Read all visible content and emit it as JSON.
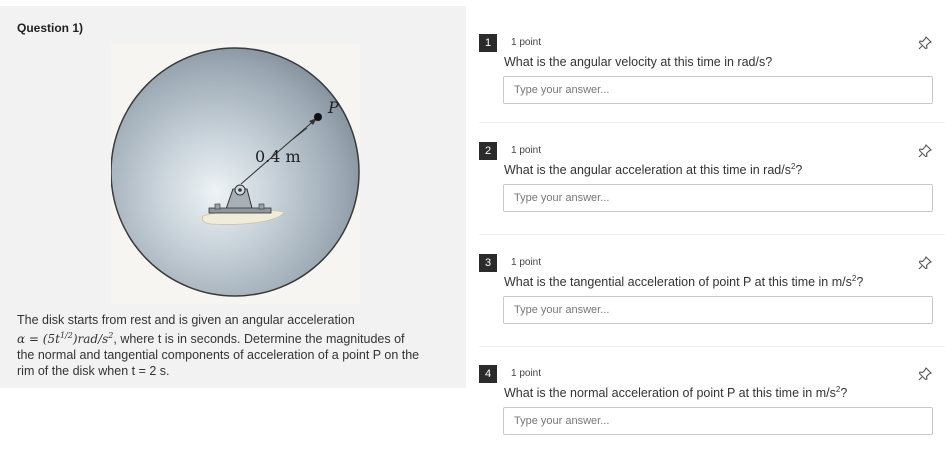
{
  "question": {
    "title": "Question 1)",
    "figure": {
      "radius_label": "0.4 m",
      "point_label": "P"
    },
    "text_line1": "The disk starts from rest and is given an angular acceleration",
    "text_formula": "α = (5t",
    "text_formula_exp": "1/2",
    "text_formula_rest": ")rad/s",
    "text_formula_sq": "2",
    "text_line2_rest": ", where t is in seconds. Determine the magnitudes of",
    "text_line3": "the normal and tangential components of acceleration of a point P on the",
    "text_line4": "rim of the disk when t = 2 s."
  },
  "sub_questions": [
    {
      "number": "1",
      "points": "1 point",
      "prompt": "What is the angular velocity at this time in rad/s?",
      "prompt_sup": "",
      "prompt_after": "",
      "placeholder": "Type your answer..."
    },
    {
      "number": "2",
      "points": "1 point",
      "prompt": "What is the angular acceleration at this time in rad/s",
      "prompt_sup": "2",
      "prompt_after": "?",
      "placeholder": "Type your answer..."
    },
    {
      "number": "3",
      "points": "1 point",
      "prompt": "What is the tangential acceleration of point P at this time in m/s",
      "prompt_sup": "2",
      "prompt_after": "?",
      "placeholder": "Type your answer..."
    },
    {
      "number": "4",
      "points": "1 point",
      "prompt": "What is the normal acceleration of point P at this time in m/s",
      "prompt_sup": "2",
      "prompt_after": "?",
      "placeholder": "Type your answer..."
    }
  ],
  "icons": {
    "pin": "pin-icon"
  }
}
